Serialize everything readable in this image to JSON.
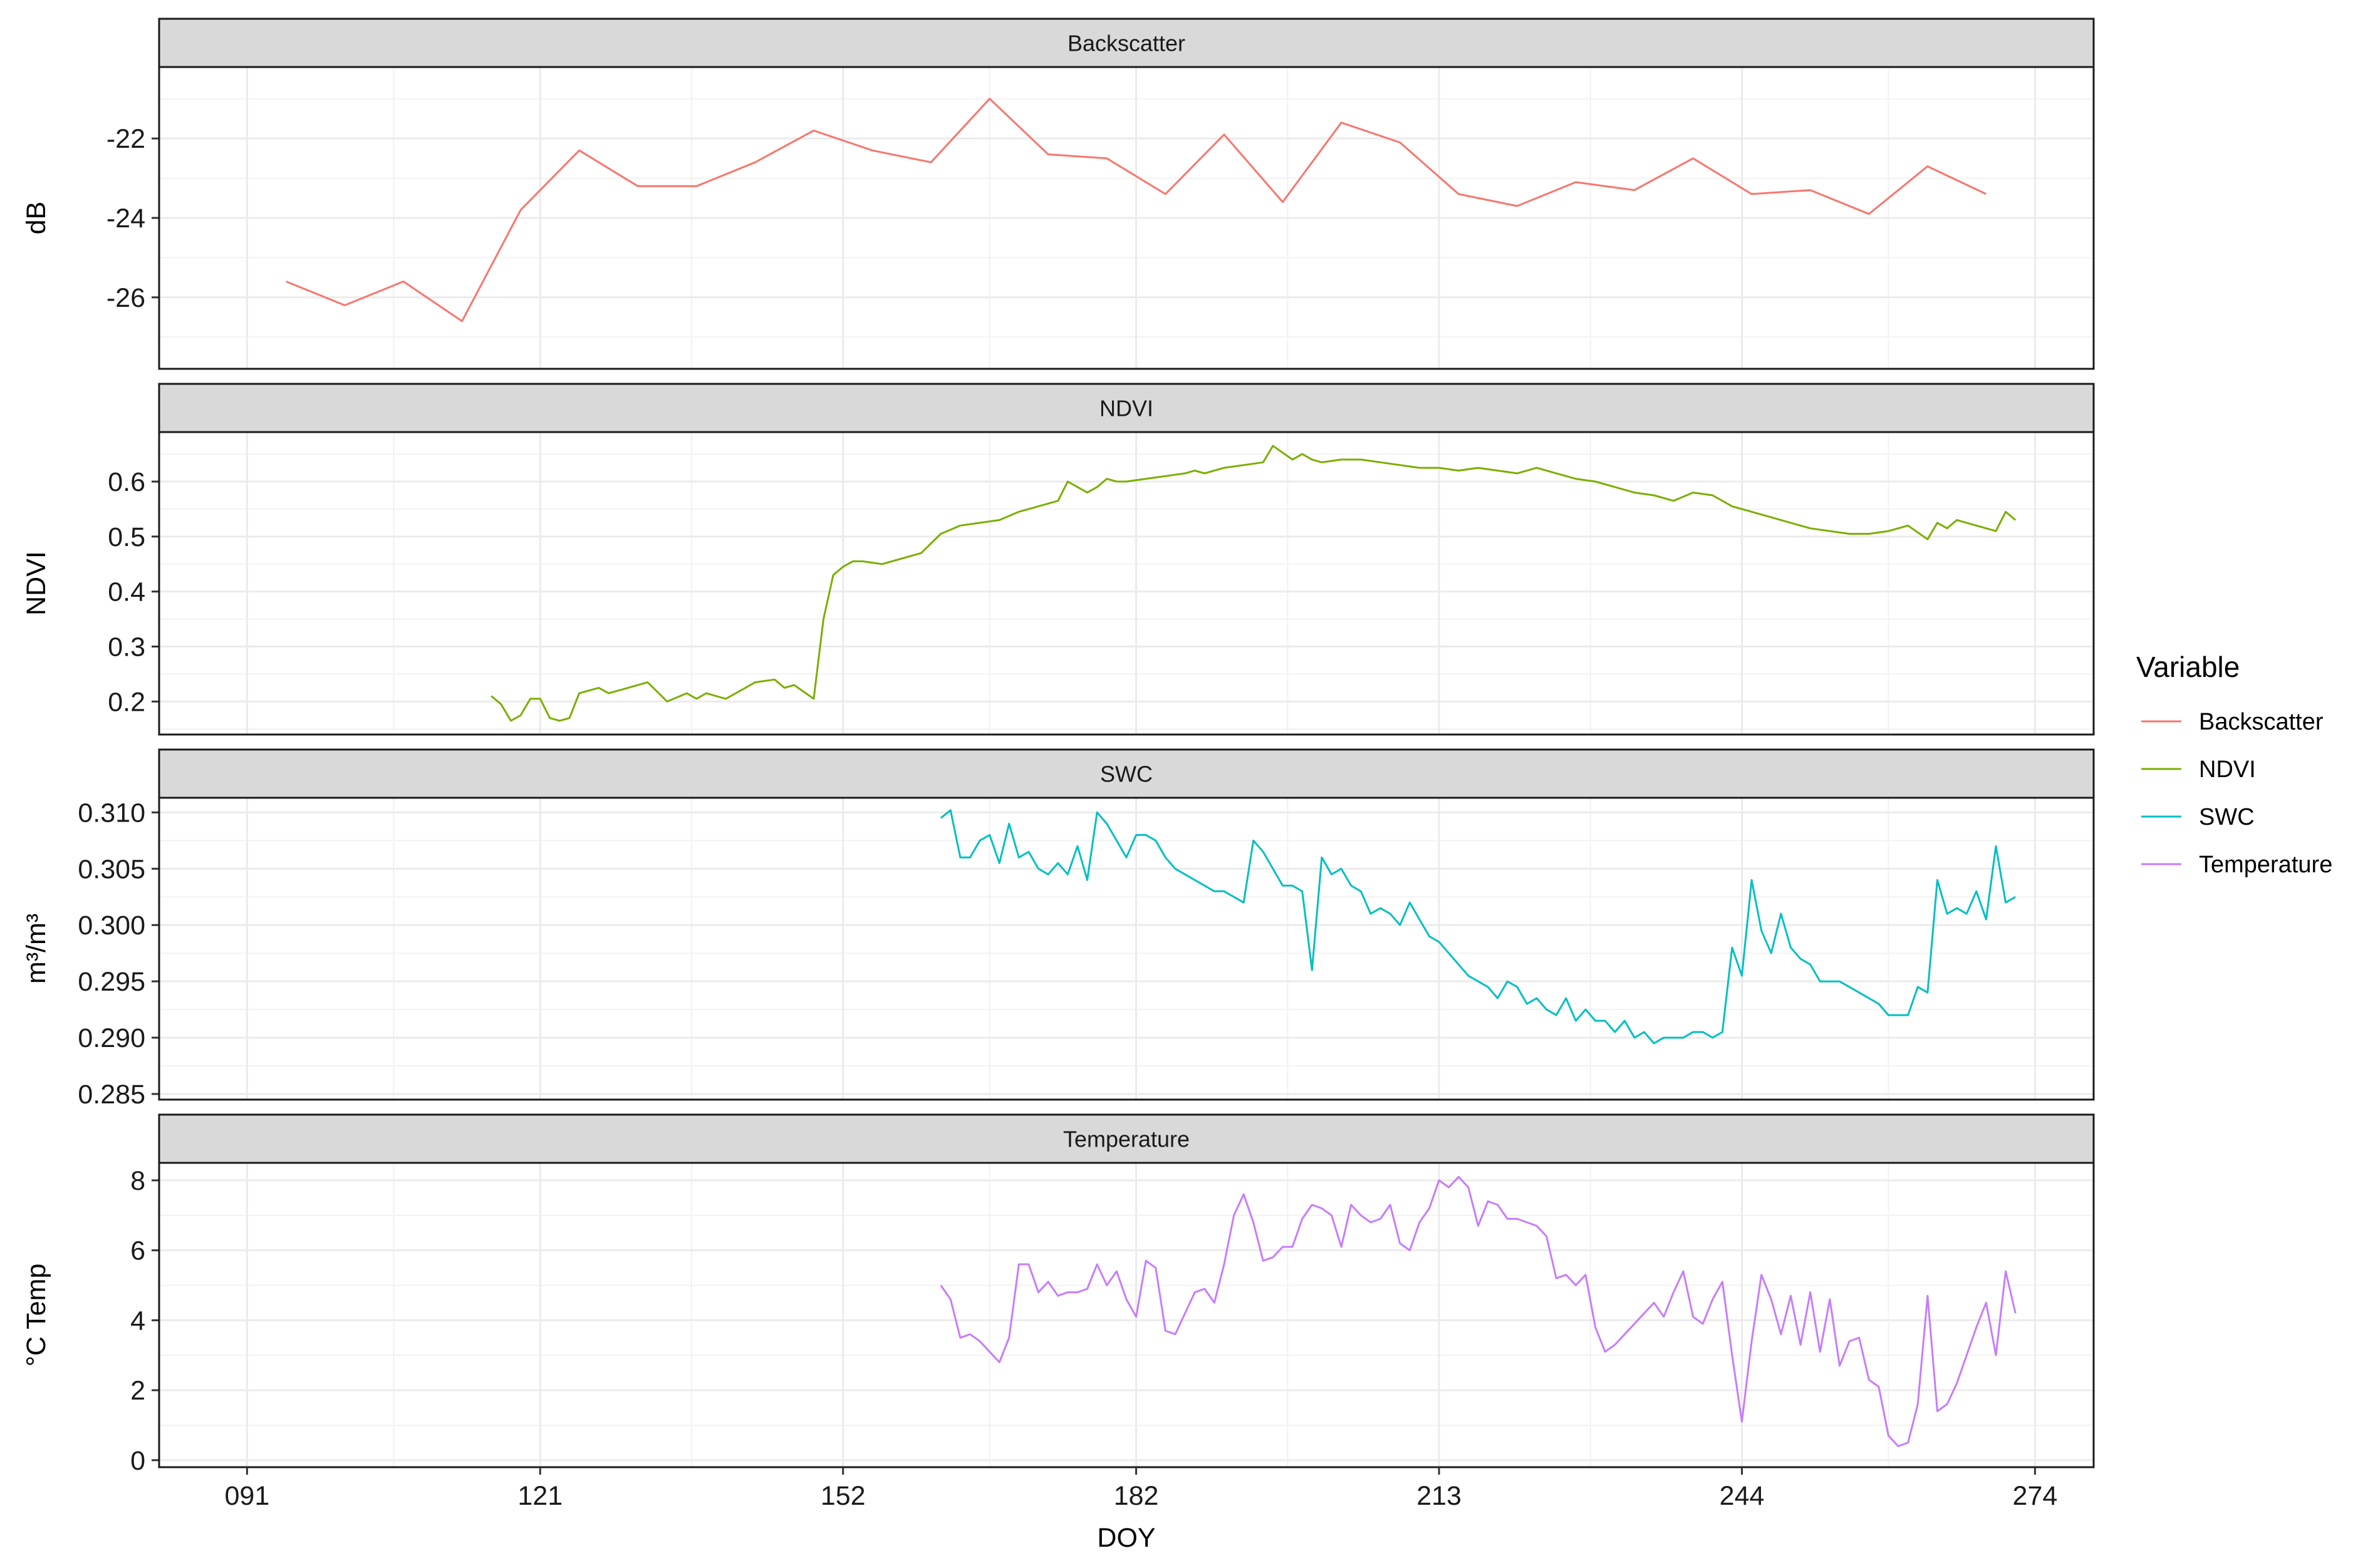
{
  "chart_data": {
    "type": "line",
    "xlabel": "DOY",
    "x_ticks": [
      "091",
      "121",
      "152",
      "182",
      "213",
      "244",
      "274"
    ],
    "x_tick_values": [
      91,
      121,
      152,
      182,
      213,
      244,
      274
    ],
    "xlim": [
      82,
      280
    ],
    "legend": {
      "title": "Variable",
      "position": "right",
      "entries": [
        {
          "name": "Backscatter",
          "color": "#F8766D"
        },
        {
          "name": "NDVI",
          "color": "#7CAE00"
        },
        {
          "name": "SWC",
          "color": "#00BFC4"
        },
        {
          "name": "Temperature",
          "color": "#C77CFF"
        }
      ]
    },
    "panels": [
      {
        "strip": "Backscatter",
        "ylabel": "dB",
        "ylim": [
          -27.8,
          -20.2
        ],
        "y_ticks": [
          -22,
          -24,
          -26
        ],
        "y_tick_labels": [
          "-22",
          "-24",
          "-26"
        ],
        "series_name": "Backscatter",
        "color": "#F8766D",
        "x": [
          95,
          101,
          107,
          113,
          119,
          125,
          131,
          137,
          143,
          149,
          155,
          161,
          167,
          173,
          179,
          185,
          191,
          197,
          203,
          209,
          215,
          221,
          227,
          233,
          239,
          245,
          251,
          257,
          263,
          269
        ],
        "y": [
          -25.6,
          -26.2,
          -25.6,
          -26.6,
          -23.8,
          -22.3,
          -23.2,
          -23.2,
          -22.6,
          -21.8,
          -22.3,
          -22.6,
          -21.0,
          -22.4,
          -22.5,
          -23.4,
          -21.9,
          -23.6,
          -21.6,
          -22.1,
          -23.4,
          -23.7,
          -23.1,
          -23.3,
          -22.5,
          -23.4,
          -23.3,
          -23.9,
          -22.7,
          -23.4
        ]
      },
      {
        "strip": "NDVI",
        "ylabel": "NDVI",
        "ylim": [
          0.14,
          0.69
        ],
        "y_ticks": [
          0.6,
          0.5,
          0.4,
          0.3,
          0.2
        ],
        "y_tick_labels": [
          "0.6",
          "0.5",
          "0.4",
          "0.3",
          "0.2"
        ],
        "series_name": "NDVI",
        "color": "#7CAE00",
        "x": [
          116,
          117,
          118,
          119,
          120,
          121,
          122,
          123,
          124,
          125,
          126,
          127,
          128,
          130,
          132,
          134,
          136,
          137,
          138,
          140,
          142,
          143,
          145,
          146,
          147,
          149,
          150,
          151,
          152,
          153,
          154,
          156,
          158,
          159,
          160,
          162,
          164,
          166,
          168,
          170,
          172,
          174,
          175,
          177,
          178,
          179,
          180,
          181,
          183,
          185,
          187,
          188,
          189,
          191,
          193,
          195,
          196,
          198,
          199,
          200,
          201,
          203,
          205,
          207,
          209,
          211,
          213,
          215,
          217,
          219,
          221,
          223,
          225,
          227,
          229,
          231,
          233,
          235,
          237,
          239,
          241,
          243,
          245,
          247,
          249,
          251,
          253,
          255,
          257,
          259,
          261,
          263,
          264,
          265,
          266,
          267,
          268,
          269,
          270,
          271,
          272
        ],
        "y": [
          0.21,
          0.195,
          0.165,
          0.175,
          0.205,
          0.205,
          0.17,
          0.165,
          0.17,
          0.215,
          0.22,
          0.225,
          0.215,
          0.225,
          0.235,
          0.2,
          0.215,
          0.205,
          0.215,
          0.205,
          0.225,
          0.235,
          0.24,
          0.225,
          0.23,
          0.205,
          0.35,
          0.43,
          0.445,
          0.455,
          0.455,
          0.45,
          0.46,
          0.465,
          0.47,
          0.505,
          0.52,
          0.525,
          0.53,
          0.545,
          0.555,
          0.565,
          0.6,
          0.58,
          0.59,
          0.605,
          0.6,
          0.6,
          0.605,
          0.61,
          0.615,
          0.62,
          0.615,
          0.625,
          0.63,
          0.635,
          0.665,
          0.64,
          0.65,
          0.64,
          0.635,
          0.64,
          0.64,
          0.635,
          0.63,
          0.625,
          0.625,
          0.62,
          0.625,
          0.62,
          0.615,
          0.625,
          0.615,
          0.605,
          0.6,
          0.59,
          0.58,
          0.575,
          0.565,
          0.58,
          0.575,
          0.555,
          0.545,
          0.535,
          0.525,
          0.515,
          0.51,
          0.505,
          0.505,
          0.51,
          0.52,
          0.495,
          0.525,
          0.515,
          0.53,
          0.525,
          0.52,
          0.515,
          0.51,
          0.545,
          0.53
        ]
      },
      {
        "strip": "SWC",
        "ylabel": "m³/m³",
        "ylim": [
          0.2845,
          0.3113
        ],
        "y_ticks": [
          0.31,
          0.305,
          0.3,
          0.295,
          0.29,
          0.285
        ],
        "y_tick_labels": [
          "0.310",
          "0.305",
          "0.300",
          "0.295",
          "0.290",
          "0.285"
        ],
        "series_name": "SWC",
        "color": "#00BFC4",
        "x": [
          162,
          163,
          164,
          165,
          166,
          167,
          168,
          169,
          170,
          171,
          172,
          173,
          174,
          175,
          176,
          177,
          178,
          179,
          180,
          181,
          182,
          183,
          184,
          185,
          186,
          187,
          188,
          189,
          190,
          191,
          192,
          193,
          194,
          195,
          196,
          197,
          198,
          199,
          200,
          201,
          202,
          203,
          204,
          205,
          206,
          207,
          208,
          209,
          210,
          211,
          212,
          213,
          214,
          215,
          216,
          217,
          218,
          219,
          220,
          221,
          222,
          223,
          224,
          225,
          226,
          227,
          228,
          229,
          230,
          231,
          232,
          233,
          234,
          235,
          236,
          237,
          238,
          239,
          240,
          241,
          242,
          243,
          244,
          245,
          246,
          247,
          248,
          249,
          250,
          251,
          252,
          253,
          254,
          255,
          256,
          257,
          258,
          259,
          260,
          261,
          262,
          263,
          264,
          265,
          266,
          267,
          268,
          269,
          270,
          271,
          272
        ],
        "y": [
          0.3095,
          0.3102,
          0.306,
          0.306,
          0.3075,
          0.308,
          0.3055,
          0.309,
          0.306,
          0.3065,
          0.305,
          0.3045,
          0.3055,
          0.3045,
          0.307,
          0.304,
          0.31,
          0.309,
          0.3075,
          0.306,
          0.308,
          0.308,
          0.3075,
          0.306,
          0.305,
          0.3045,
          0.304,
          0.3035,
          0.303,
          0.303,
          0.3025,
          0.302,
          0.3075,
          0.3065,
          0.305,
          0.3035,
          0.3035,
          0.303,
          0.296,
          0.306,
          0.3045,
          0.305,
          0.3035,
          0.303,
          0.301,
          0.3015,
          0.301,
          0.3,
          0.302,
          0.3005,
          0.299,
          0.2985,
          0.2975,
          0.2965,
          0.2955,
          0.295,
          0.2945,
          0.2935,
          0.295,
          0.2945,
          0.293,
          0.2935,
          0.2925,
          0.292,
          0.2935,
          0.2915,
          0.2925,
          0.2915,
          0.2915,
          0.2905,
          0.2915,
          0.29,
          0.2905,
          0.2895,
          0.29,
          0.29,
          0.29,
          0.2905,
          0.2905,
          0.29,
          0.2905,
          0.298,
          0.2955,
          0.304,
          0.2995,
          0.2975,
          0.301,
          0.298,
          0.297,
          0.2965,
          0.295,
          0.295,
          0.295,
          0.2945,
          0.294,
          0.2935,
          0.293,
          0.292,
          0.292,
          0.292,
          0.2945,
          0.294,
          0.304,
          0.301,
          0.3015,
          0.301,
          0.303,
          0.3005,
          0.307,
          0.302,
          0.3025
        ]
      },
      {
        "strip": "Temperature",
        "ylabel": "°C Temp",
        "ylim": [
          -0.2,
          8.5
        ],
        "y_ticks": [
          8,
          6,
          4,
          2,
          0
        ],
        "y_tick_labels": [
          "8",
          "6",
          "4",
          "2",
          "0"
        ],
        "series_name": "Temperature",
        "color": "#C77CFF",
        "x": [
          162,
          163,
          164,
          165,
          166,
          167,
          168,
          169,
          170,
          171,
          172,
          173,
          174,
          175,
          176,
          177,
          178,
          179,
          180,
          181,
          182,
          183,
          184,
          185,
          186,
          187,
          188,
          189,
          190,
          191,
          192,
          193,
          194,
          195,
          196,
          197,
          198,
          199,
          200,
          201,
          202,
          203,
          204,
          205,
          206,
          207,
          208,
          209,
          210,
          211,
          212,
          213,
          214,
          215,
          216,
          217,
          218,
          219,
          220,
          221,
          222,
          223,
          224,
          225,
          226,
          227,
          228,
          229,
          230,
          231,
          232,
          233,
          234,
          235,
          236,
          237,
          238,
          239,
          240,
          241,
          242,
          243,
          244,
          245,
          246,
          247,
          248,
          249,
          250,
          251,
          252,
          253,
          254,
          255,
          256,
          257,
          258,
          259,
          260,
          261,
          262,
          263,
          264,
          265,
          266,
          267,
          268,
          269,
          270,
          271,
          272
        ],
        "y": [
          5.0,
          4.6,
          3.5,
          3.6,
          3.4,
          3.1,
          2.8,
          3.5,
          5.6,
          5.6,
          4.8,
          5.1,
          4.7,
          4.8,
          4.8,
          4.9,
          5.6,
          5.0,
          5.4,
          4.6,
          4.1,
          5.7,
          5.5,
          3.7,
          3.6,
          4.2,
          4.8,
          4.9,
          4.5,
          5.6,
          7.0,
          7.6,
          6.8,
          5.7,
          5.8,
          6.1,
          6.1,
          6.9,
          7.3,
          7.2,
          7.0,
          6.1,
          7.3,
          7.0,
          6.8,
          6.9,
          7.3,
          6.2,
          6.0,
          6.8,
          7.2,
          8.0,
          7.8,
          8.1,
          7.8,
          6.7,
          7.4,
          7.3,
          6.9,
          6.9,
          6.8,
          6.7,
          6.4,
          5.2,
          5.3,
          5.0,
          5.3,
          3.8,
          3.1,
          3.3,
          3.6,
          3.9,
          4.2,
          4.5,
          4.1,
          4.8,
          5.4,
          4.1,
          3.9,
          4.6,
          5.1,
          3.0,
          1.1,
          3.4,
          5.3,
          4.6,
          3.6,
          4.7,
          3.3,
          4.8,
          3.1,
          4.6,
          2.7,
          3.4,
          3.5,
          2.3,
          2.1,
          0.7,
          0.4,
          0.5,
          1.6,
          4.7,
          1.4,
          1.6,
          2.2,
          3.0,
          3.8,
          4.5,
          3.0,
          5.4,
          4.2
        ]
      }
    ]
  }
}
